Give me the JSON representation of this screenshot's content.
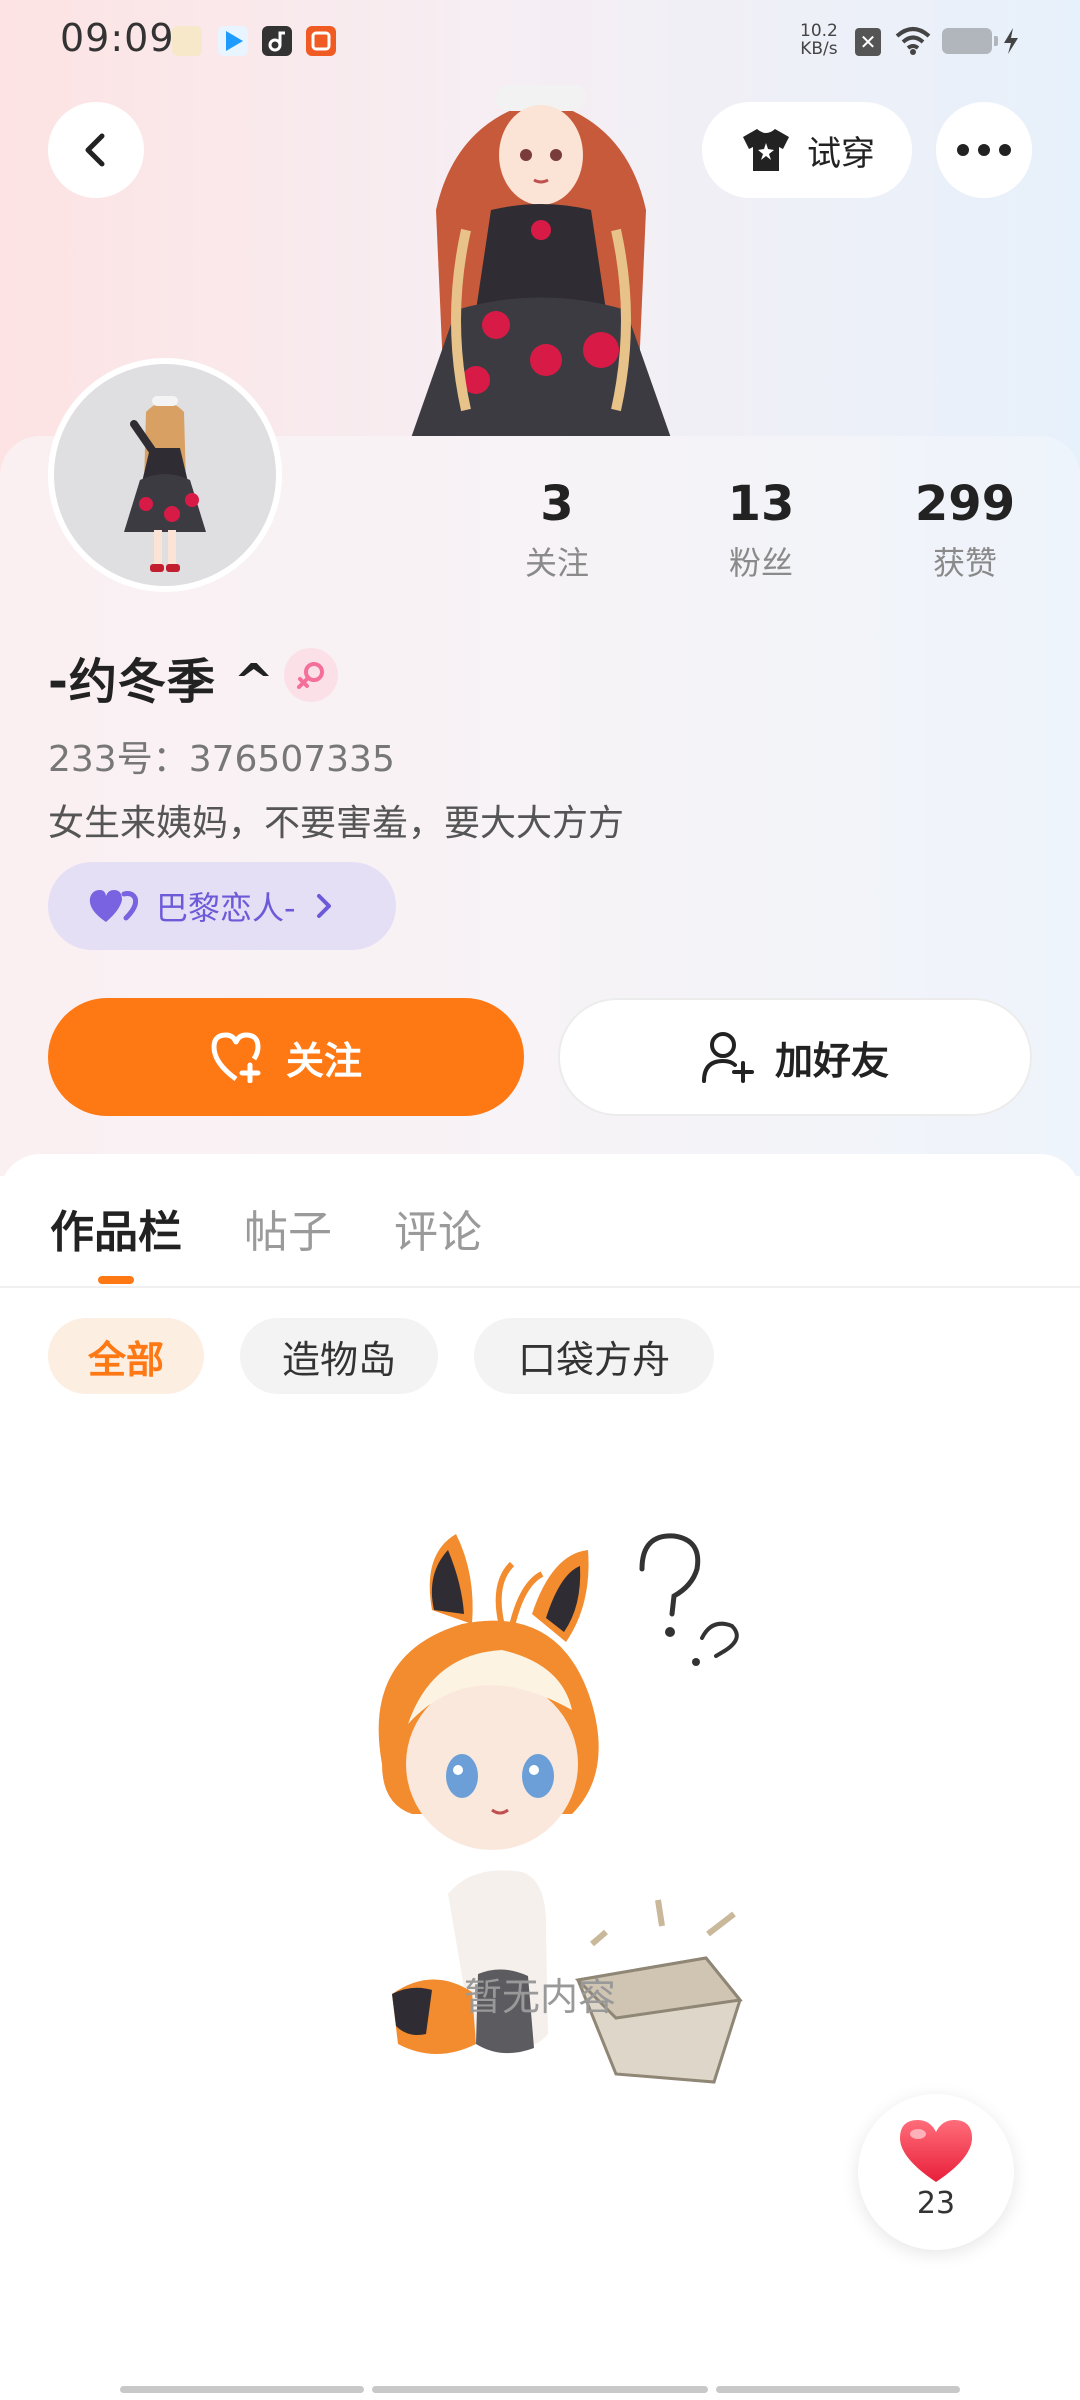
{
  "status_bar": {
    "time": "09:09",
    "net_speed_value": "10.2",
    "net_speed_unit": "KB/s"
  },
  "header": {
    "try_on_label": "试穿"
  },
  "profile": {
    "stats": [
      {
        "value": "3",
        "label": "关注"
      },
      {
        "value": "13",
        "label": "粉丝"
      },
      {
        "value": "299",
        "label": "获赞"
      }
    ],
    "nickname": "-约冬季 ^",
    "uid": "233号：376507335",
    "bio": "女生来姨妈，不要害羞，要大大方方",
    "tag": "巴黎恋人-"
  },
  "actions": {
    "follow_label": "关注",
    "add_friend_label": "加好友"
  },
  "tabs": [
    "作品栏",
    "帖子",
    "评论"
  ],
  "filters": [
    "全部",
    "造物岛",
    "口袋方舟"
  ],
  "empty_state": {
    "text": "暂无内容"
  },
  "like_fab": {
    "count": "23"
  },
  "colors": {
    "accent": "#fe7814",
    "tag_bg": "#e5dff6",
    "tag_text": "#6c5ad8",
    "heart": "#f4374e"
  }
}
